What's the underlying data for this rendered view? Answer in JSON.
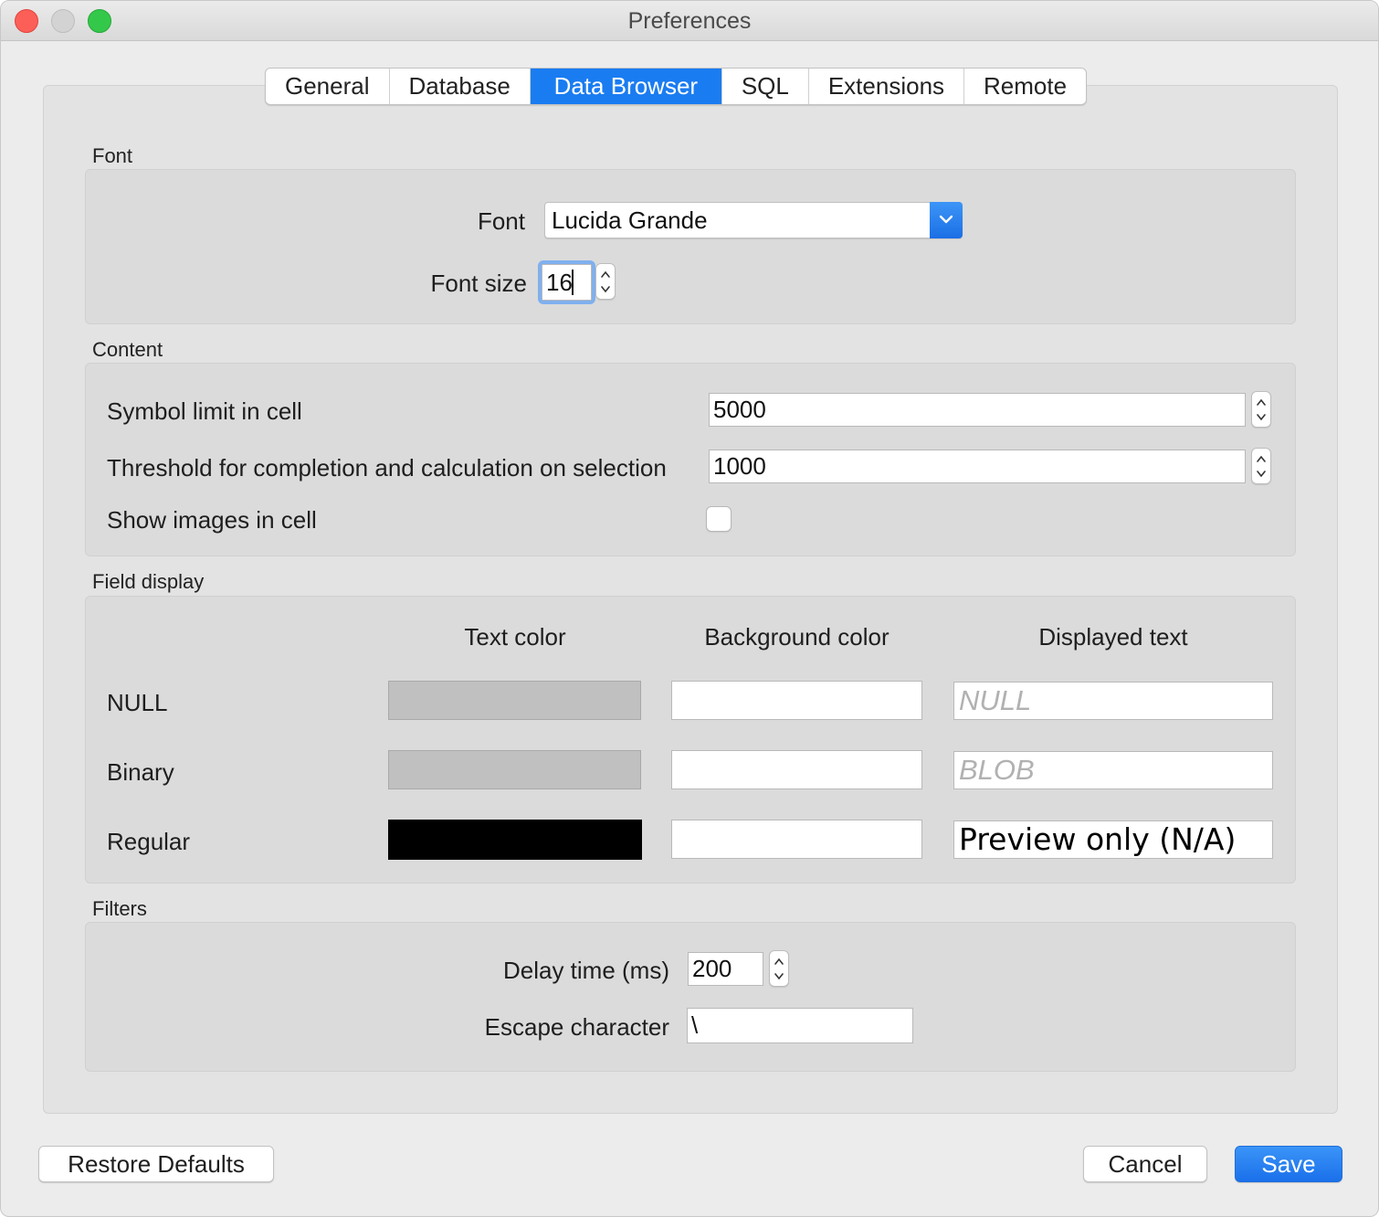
{
  "window": {
    "title": "Preferences"
  },
  "tabs": [
    {
      "label": "General",
      "active": false
    },
    {
      "label": "Database",
      "active": false
    },
    {
      "label": "Data Browser",
      "active": true
    },
    {
      "label": "SQL",
      "active": false
    },
    {
      "label": "Extensions",
      "active": false
    },
    {
      "label": "Remote",
      "active": false
    }
  ],
  "font_group": {
    "title": "Font",
    "font_label": "Font",
    "font_value": "Lucida Grande",
    "size_label": "Font size",
    "size_value": "16"
  },
  "content_group": {
    "title": "Content",
    "symbol_limit_label": "Symbol limit in cell",
    "symbol_limit_value": "5000",
    "threshold_label": "Threshold for completion and calculation on selection",
    "threshold_value": "1000",
    "show_images_label": "Show images in cell",
    "show_images_checked": false
  },
  "field_display": {
    "title": "Field display",
    "headers": {
      "text_color": "Text color",
      "background_color": "Background color",
      "displayed_text": "Displayed text"
    },
    "rows": [
      {
        "label": "NULL",
        "text_color": "#c0c0c0",
        "background_color": "#ffffff",
        "displayed_text": "NULL"
      },
      {
        "label": "Binary",
        "text_color": "#c0c0c0",
        "background_color": "#ffffff",
        "displayed_text": "BLOB"
      },
      {
        "label": "Regular",
        "text_color": "#000000",
        "background_color": "#ffffff",
        "displayed_text": "Preview only (N/A)"
      }
    ]
  },
  "filters_group": {
    "title": "Filters",
    "delay_label": "Delay time (ms)",
    "delay_value": "200",
    "escape_label": "Escape character",
    "escape_value": "\\"
  },
  "buttons": {
    "restore": "Restore Defaults",
    "cancel": "Cancel",
    "save": "Save"
  },
  "colors": {
    "accent": "#1a7cf1"
  }
}
